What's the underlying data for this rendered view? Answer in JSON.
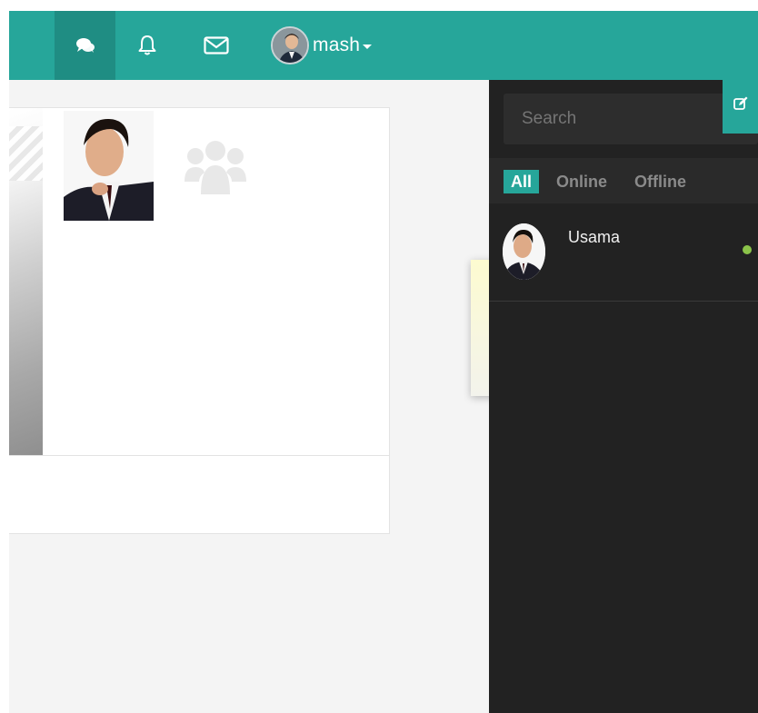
{
  "navbar": {
    "user_name": "mash",
    "icons": [
      "chat-icon",
      "bell-icon",
      "mail-icon"
    ],
    "color": "#26a69a"
  },
  "sidebar": {
    "search_placeholder": "Search",
    "filters": [
      "All",
      "Online",
      "Offline"
    ],
    "active_filter": "All",
    "contacts": [
      {
        "name": "Usama",
        "status": "online"
      }
    ]
  },
  "colors": {
    "accent": "#26a69a",
    "sidebar_bg": "#222222",
    "online": "#8bc34a"
  }
}
